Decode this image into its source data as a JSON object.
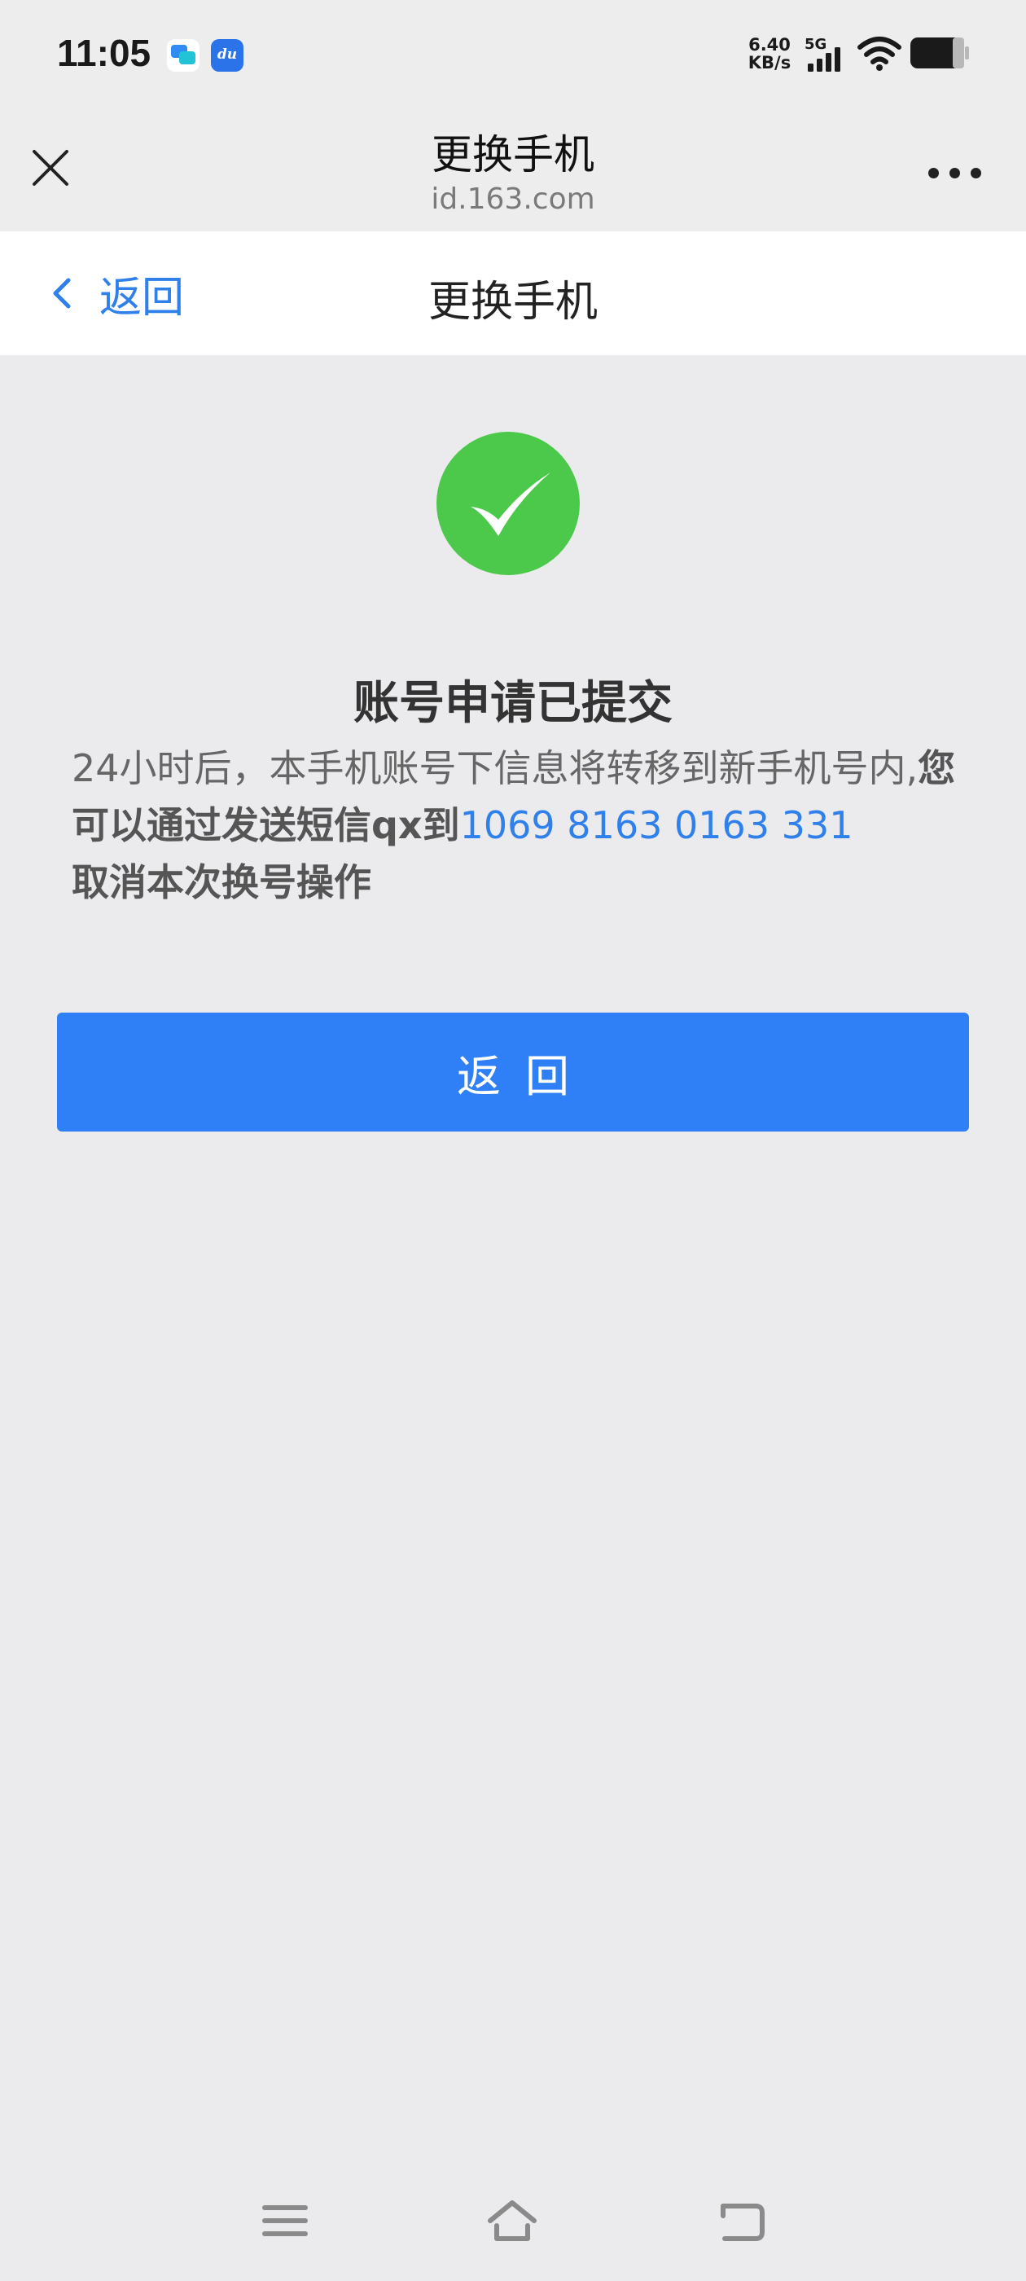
{
  "status_bar": {
    "time": "11:05",
    "net_speed_value": "6.40",
    "net_speed_unit": "KB/s",
    "network_type": "5G",
    "icons": [
      "message-app-icon",
      "du-app-icon",
      "signal-icon",
      "wifi-icon",
      "battery-icon"
    ]
  },
  "browser": {
    "title": "更换手机",
    "domain": "id.163.com",
    "icons": [
      "close-icon",
      "more-icon"
    ]
  },
  "header": {
    "back_label": "返回",
    "title": "更换手机"
  },
  "content": {
    "heading": "账号申请已提交",
    "notice_plain": "24小时后，本手机账号下信息将转移到新手机号内,",
    "notice_bold_before": "您可以通过发送短信qx到",
    "sms_number": "1069 8163 0163 331",
    "notice_bold_after": "取消本次换号操作",
    "button_label": "返回"
  },
  "nav_bar": {
    "buttons": [
      "menu-icon",
      "home-icon",
      "back-icon"
    ]
  },
  "colors": {
    "accent": "#2f80f6",
    "link": "#2f80ea",
    "success": "#4cc94a",
    "background": "#ebebee"
  }
}
